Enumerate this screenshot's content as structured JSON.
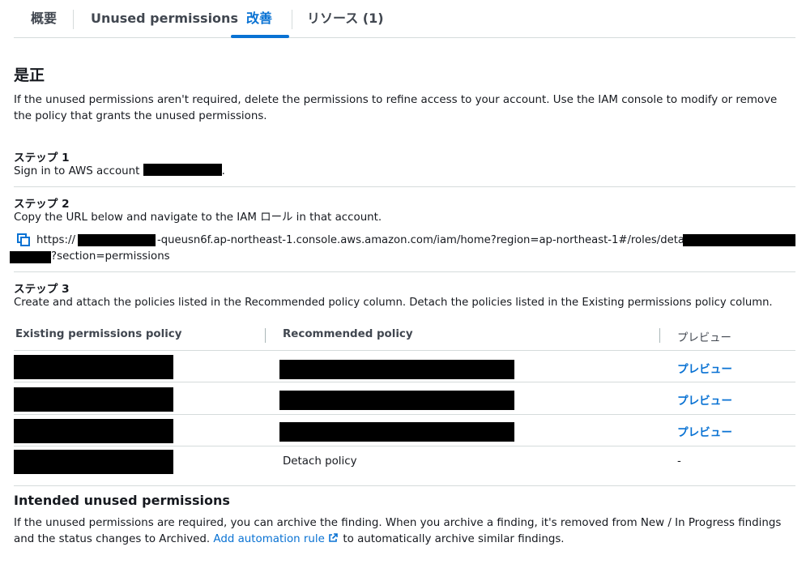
{
  "tabs": [
    {
      "label": "概要"
    },
    {
      "label": "Unused permissions"
    },
    {
      "label": "改善"
    },
    {
      "label": "リソース (1)"
    }
  ],
  "remediation": {
    "title": "是正",
    "intro": "If the unused permissions aren't required, delete the permissions to refine access to your account. Use the IAM console to modify or remove the policy that grants the unused permissions.",
    "step1": {
      "title": "ステップ 1",
      "text_prefix": "Sign in to AWS account",
      "text_suffix": "."
    },
    "step2": {
      "title": "ステップ 2",
      "text": "Copy the URL below and navigate to the IAM ロール in that account.",
      "url_prefix": "https://",
      "url_middle": "-queusn6f.ap-northeast-1.console.aws.amazon.com/iam/home?region=ap-northeast-1#/roles/details/",
      "url_suffix": "?section=permissions"
    },
    "step3": {
      "title": "ステップ 3",
      "text": "Create and attach the policies listed in the Recommended policy column. Detach the policies listed in the Existing permissions policy column."
    }
  },
  "policy_table": {
    "headers": [
      "Existing permissions policy",
      "Recommended policy",
      "プレビュー"
    ],
    "rows": [
      {
        "action": "プレビュー"
      },
      {
        "action": "プレビュー"
      },
      {
        "action": "プレビュー"
      },
      {
        "recommended": "Detach policy",
        "action": "-"
      }
    ]
  },
  "intended": {
    "title": "Intended unused permissions",
    "text_before": "If the unused permissions are required, you can archive the finding. When you archive a finding, it's removed from New / In Progress findings and the status changes to Archived.",
    "link": "Add automation rule",
    "text_after": "to automatically archive similar findings."
  },
  "colors": {
    "accent": "#0972d3",
    "text": "#16191f",
    "divider": "#d5dbdb"
  },
  "icons": [
    "copy-icon",
    "external-link-icon"
  ]
}
